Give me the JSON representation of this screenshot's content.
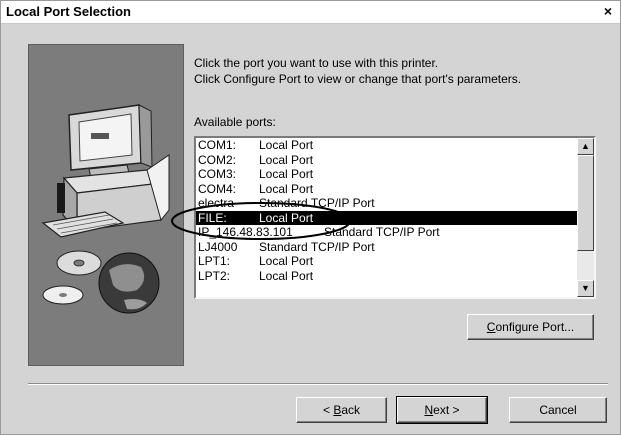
{
  "window": {
    "title": "Local Port Selection",
    "close_glyph": "×"
  },
  "instructions": {
    "line1": "Click the port you want to use with this printer.",
    "line2": "Click Configure Port to view or change that port's parameters."
  },
  "ports_label": "Available ports:",
  "ports": [
    {
      "port": "COM1:",
      "desc": "Local Port"
    },
    {
      "port": "COM2:",
      "desc": "Local Port"
    },
    {
      "port": "COM3:",
      "desc": "Local Port"
    },
    {
      "port": "COM4:",
      "desc": "Local Port"
    },
    {
      "port": "electra",
      "desc": "Standard TCP/IP Port"
    },
    {
      "port": "FILE:",
      "desc": "Local Port",
      "selected": true
    },
    {
      "port": "IP_146.48.83.101",
      "desc": "Standard TCP/IP Port"
    },
    {
      "port": "LJ4000",
      "desc": "Standard TCP/IP Port"
    },
    {
      "port": "LPT1:",
      "desc": "Local Port"
    },
    {
      "port": "LPT2:",
      "desc": "Local Port"
    }
  ],
  "buttons": {
    "configure": {
      "pre": "",
      "mnemonic": "C",
      "post": "onfigure Port..."
    },
    "back": {
      "pre": "< ",
      "mnemonic": "B",
      "post": "ack"
    },
    "next": {
      "pre": "",
      "mnemonic": "N",
      "post": "ext >"
    },
    "cancel": "Cancel"
  },
  "colors": {
    "selection": "#000000",
    "dialog_bg": "#d4d4d4",
    "illustration_bg": "#7c7c7c",
    "annotation_ring": "#000000"
  },
  "icons": {
    "scroll_up": "triangle-up-icon",
    "scroll_down": "triangle-down-icon",
    "illustration": "computer-with-discs-illustration"
  }
}
